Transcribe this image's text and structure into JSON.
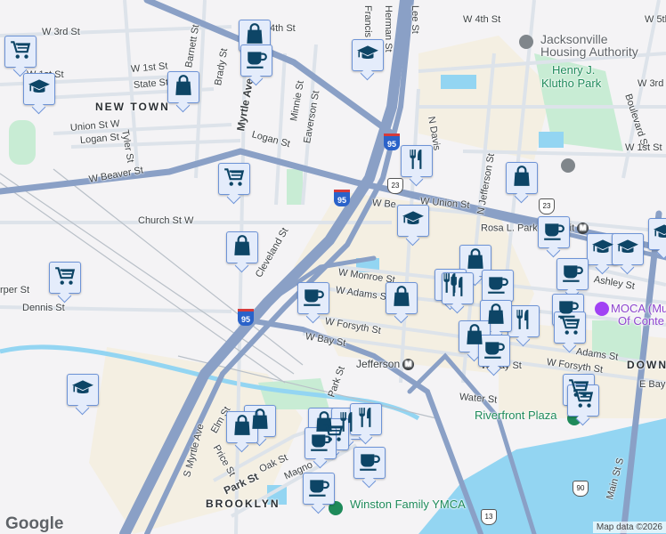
{
  "labels": [
    "W 3rd St",
    "W 1st St",
    "W 1st St",
    "State St",
    "NEW TOWN",
    "Union St W",
    "Logan St",
    "Tyler St",
    "W Beaver St",
    "Barnett St",
    "Brady St",
    "4th St",
    "Myrtle Ave",
    "Minnie St",
    "Eaverson St",
    "Logan St",
    "Church St W",
    "Cleveland St",
    "Dennis St",
    "rper St",
    "W Monroe St",
    "W Adams St",
    "W Forsyth St",
    "W Bay St",
    "Jefferson",
    "Water St",
    "Riverfront Plaza",
    "Park St",
    "S Myrtle Ave",
    "Park St",
    "Oak St",
    "Magno",
    "Price St",
    "BROOKLYN",
    "Winston Family YMCA",
    "Jacksonville",
    "Housing Authority",
    "Henry J.",
    "Klutho Park",
    "W 4th St",
    "W 5th St",
    "W 3rd St",
    "Boulevard St",
    "W 1st St",
    "N Jefferson St",
    "N Davis",
    "Lee St",
    "Herman St",
    "Francis",
    "W Union St",
    "W Be",
    "Rosa L. Parks Transit",
    "Ashley St",
    "MOCA (Museum",
    "Of Conte",
    "Adams St",
    "DOWN",
    "W Forsyth St",
    "W Bay St",
    "Main St S",
    "E Bay",
    "Elm St"
  ],
  "highway_shields": [
    "95",
    "95",
    "95",
    "23",
    "23",
    "90",
    "13"
  ],
  "metro_icon": "M",
  "markers": [
    {
      "type": "shopping-cart"
    },
    {
      "type": "graduation-cap"
    },
    {
      "type": "shopping-bag"
    },
    {
      "type": "shopping-bag"
    },
    {
      "type": "coffee"
    },
    {
      "type": "graduation-cap"
    },
    {
      "type": "restaurant"
    },
    {
      "type": "shopping-bag"
    },
    {
      "type": "shopping-cart"
    },
    {
      "type": "shopping-bag"
    },
    {
      "type": "graduation-cap"
    },
    {
      "type": "shopping-cart"
    },
    {
      "type": "coffee"
    },
    {
      "type": "graduation-cap"
    },
    {
      "type": "graduation-cap"
    },
    {
      "type": "graduation-cap"
    },
    {
      "type": "shopping-bag"
    },
    {
      "type": "coffee"
    },
    {
      "type": "restaurant"
    },
    {
      "type": "restaurant"
    },
    {
      "type": "coffee"
    },
    {
      "type": "coffee"
    },
    {
      "type": "restaurant"
    },
    {
      "type": "shopping-cart"
    },
    {
      "type": "shopping-bag"
    },
    {
      "type": "coffee"
    },
    {
      "type": "shopping-bag"
    },
    {
      "type": "shopping-bag"
    },
    {
      "type": "coffee"
    },
    {
      "type": "graduation-cap"
    },
    {
      "type": "shopping-cart"
    },
    {
      "type": "shopping-cart"
    },
    {
      "type": "shopping-bag"
    },
    {
      "type": "shopping-bag"
    },
    {
      "type": "shopping-bag"
    },
    {
      "type": "restaurant"
    },
    {
      "type": "restaurant"
    },
    {
      "type": "shopping-cart"
    },
    {
      "type": "coffee"
    },
    {
      "type": "coffee"
    },
    {
      "type": "coffee"
    }
  ],
  "footer": {
    "logo": "Google",
    "attribution": "Map data ©2026"
  },
  "colors": {
    "marker_bg": "#e4ecfb",
    "marker_border": "#6d93d6",
    "icon": "#0d4566",
    "highway": "#8aa0c6",
    "water": "#93d5f2",
    "park": "#c8ecd4"
  }
}
